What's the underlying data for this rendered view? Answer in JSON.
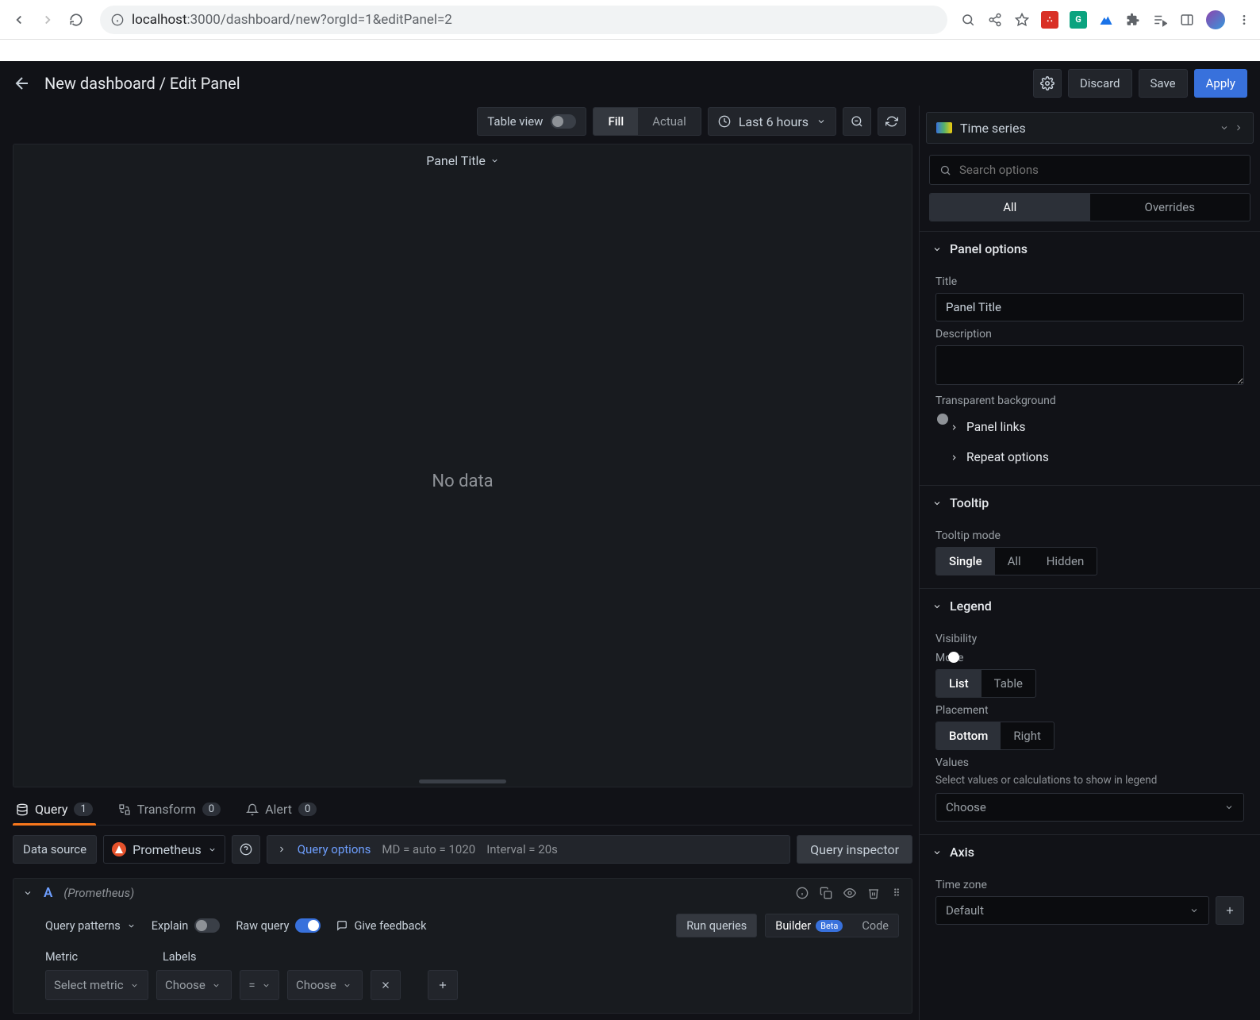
{
  "browser": {
    "url_host": "localhost",
    "url_port": ":3000",
    "url_path": "/dashboard/new?orgId=1&editPanel=2"
  },
  "topbar": {
    "breadcrumb": "New dashboard / Edit Panel",
    "discard": "Discard",
    "save": "Save",
    "apply": "Apply"
  },
  "preview_toolbar": {
    "table_view": "Table view",
    "fill": "Fill",
    "actual": "Actual",
    "time_range": "Last 6 hours"
  },
  "panel": {
    "title": "Panel Title",
    "no_data": "No data"
  },
  "tabs": {
    "query": "Query",
    "query_count": "1",
    "transform": "Transform",
    "transform_count": "0",
    "alert": "Alert",
    "alert_count": "0"
  },
  "ds_row": {
    "label": "Data source",
    "name": "Prometheus",
    "query_options": "Query options",
    "md": "MD = auto = 1020",
    "interval": "Interval = 20s",
    "inspector": "Query inspector"
  },
  "query_editor": {
    "letter": "A",
    "ds_hint": "(Prometheus)",
    "patterns": "Query patterns",
    "explain": "Explain",
    "raw_query": "Raw query",
    "feedback": "Give feedback",
    "run": "Run queries",
    "builder": "Builder",
    "beta": "Beta",
    "code": "Code",
    "metric_label": "Metric",
    "labels_label": "Labels",
    "select_metric": "Select metric",
    "choose": "Choose",
    "eq": "="
  },
  "right": {
    "viz_name": "Time series",
    "search_placeholder": "Search options",
    "tab_all": "All",
    "tab_overrides": "Overrides",
    "panel_options": {
      "header": "Panel options",
      "title_label": "Title",
      "title_value": "Panel Title",
      "description_label": "Description",
      "transparent_label": "Transparent background",
      "panel_links": "Panel links",
      "repeat_options": "Repeat options"
    },
    "tooltip": {
      "header": "Tooltip",
      "mode_label": "Tooltip mode",
      "single": "Single",
      "all": "All",
      "hidden": "Hidden"
    },
    "legend": {
      "header": "Legend",
      "visibility_label": "Visibility",
      "mode_label": "Mode",
      "list": "List",
      "table": "Table",
      "placement_label": "Placement",
      "bottom": "Bottom",
      "right": "Right",
      "values_label": "Values",
      "values_desc": "Select values or calculations to show in legend",
      "choose": "Choose"
    },
    "axis": {
      "header": "Axis",
      "timezone_label": "Time zone",
      "default": "Default"
    }
  }
}
